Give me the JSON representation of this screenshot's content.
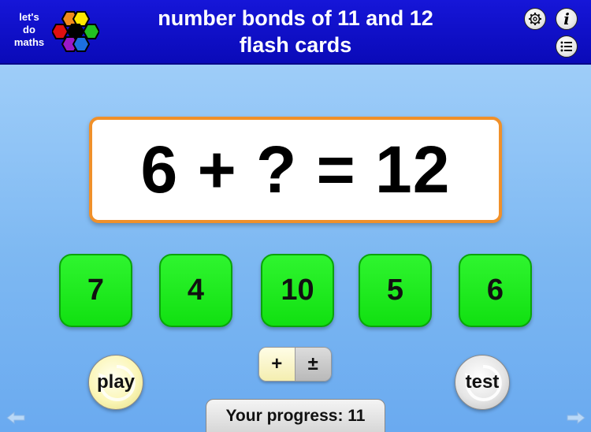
{
  "header": {
    "logo_text_1": "let's",
    "logo_text_2": "do",
    "logo_text_3": "maths",
    "title_line_1": "number bonds of 11 and 12",
    "title_line_2": "flash cards",
    "info_label": "i"
  },
  "card": {
    "question": "6 + ? = 12"
  },
  "answers": [
    "7",
    "4",
    "10",
    "5",
    "6"
  ],
  "controls": {
    "play_label": "play",
    "test_label": "test",
    "mode_plus": "+",
    "mode_plus_minus": "±"
  },
  "progress": {
    "label": "Your progress: 11"
  },
  "icons": {
    "settings": "gear-icon",
    "info": "info-icon",
    "list": "list-icon",
    "nav_left": "arrow-left-icon",
    "nav_right": "arrow-right-icon"
  },
  "colors": {
    "header_bg": "#0a0ab8",
    "card_border": "#f0902a",
    "answer_bg": "#11e011",
    "page_bg": "#7db8f2"
  }
}
